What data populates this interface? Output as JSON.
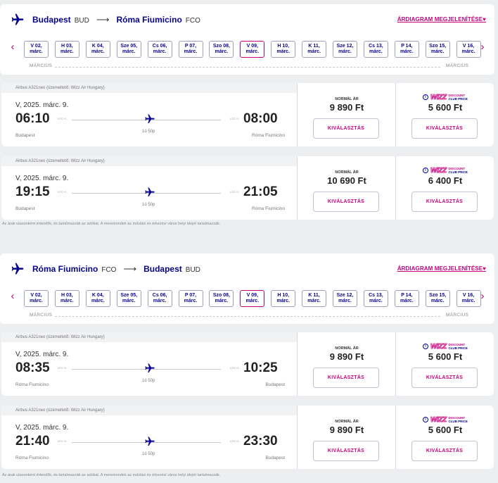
{
  "outbound": {
    "from_city": "Budapest",
    "from_code": "BUD",
    "arrow": "⟶",
    "to_city": "Róma Fiumicino",
    "to_code": "FCO",
    "price_diagram": "ÁRDIAGRAM MEGJELENÍTÉSE♥",
    "dates": [
      {
        "day": "V 02,",
        "month": "márc."
      },
      {
        "day": "H 03,",
        "month": "márc."
      },
      {
        "day": "K 04,",
        "month": "márc."
      },
      {
        "day": "Sze 05,",
        "month": "márc."
      },
      {
        "day": "Cs 06,",
        "month": "márc."
      },
      {
        "day": "P 07,",
        "month": "márc."
      },
      {
        "day": "Szo 08,",
        "month": "márc."
      },
      {
        "day": "V 09,",
        "month": "márc.",
        "selected": true
      },
      {
        "day": "H 10,",
        "month": "márc."
      },
      {
        "day": "K 11,",
        "month": "márc."
      },
      {
        "day": "Sze 12,",
        "month": "márc."
      },
      {
        "day": "Cs 13,",
        "month": "márc."
      },
      {
        "day": "P 14,",
        "month": "márc."
      },
      {
        "day": "Szo 15,",
        "month": "márc."
      },
      {
        "day": "V 16,",
        "month": "márc."
      }
    ],
    "month_left": "MÁRCIUS",
    "month_right": "MÁRCIUS",
    "flights": [
      {
        "operator": "Airbus A321neo (üzemeltető: Wizz Air Hungary)",
        "date": "V, 2025. márc. 9.",
        "dep_time": "06:10",
        "dep_utc": "UTC+1",
        "arr_time": "08:00",
        "arr_utc": "UTC+1",
        "duration": "1ó 50p",
        "dep_city": "Budapest",
        "arr_city": "Róma Fiumicino",
        "normal_label": "NORMÁL ÁR",
        "normal_price": "9 890 Ft",
        "club_price": "5 600 Ft",
        "select": "KIVÁLASZTÁS"
      },
      {
        "operator": "Airbus A321neo (üzemeltető: Wizz Air Hungary)",
        "date": "V, 2025. márc. 9.",
        "dep_time": "19:15",
        "dep_utc": "UTC+1",
        "arr_time": "21:05",
        "arr_utc": "UTC+1",
        "duration": "1ó 50p",
        "dep_city": "Budapest",
        "arr_city": "Róma Fiumicino",
        "normal_label": "NORMÁL ÁR",
        "normal_price": "10 690 Ft",
        "club_price": "6 400 Ft",
        "select": "KIVÁLASZTÁS"
      }
    ]
  },
  "inbound": {
    "from_city": "Róma Fiumicino",
    "from_code": "FCO",
    "arrow": "⟶",
    "to_city": "Budapest",
    "to_code": "BUD",
    "price_diagram": "ÁRDIAGRAM MEGJELENÍTÉSE♥",
    "dates": [
      {
        "day": "V 02,",
        "month": "márc."
      },
      {
        "day": "H 03,",
        "month": "márc."
      },
      {
        "day": "K 04,",
        "month": "márc."
      },
      {
        "day": "Sze 05,",
        "month": "márc."
      },
      {
        "day": "Cs 06,",
        "month": "márc."
      },
      {
        "day": "P 07,",
        "month": "márc."
      },
      {
        "day": "Szo 08,",
        "month": "márc."
      },
      {
        "day": "V 09,",
        "month": "márc.",
        "selected": true
      },
      {
        "day": "H 10,",
        "month": "márc."
      },
      {
        "day": "K 11,",
        "month": "márc."
      },
      {
        "day": "Sze 12,",
        "month": "márc."
      },
      {
        "day": "Cs 13,",
        "month": "márc."
      },
      {
        "day": "P 14,",
        "month": "márc."
      },
      {
        "day": "Szo 15,",
        "month": "márc."
      },
      {
        "day": "V 16,",
        "month": "márc."
      }
    ],
    "month_left": "MÁRCIUS",
    "month_right": "MÁRCIUS",
    "flights": [
      {
        "operator": "Airbus A321neo (üzemeltető: Wizz Air Hungary)",
        "date": "V, 2025. márc. 9.",
        "dep_time": "08:35",
        "dep_utc": "UTC+1",
        "arr_time": "10:25",
        "arr_utc": "UTC+1",
        "duration": "1ó 50p",
        "dep_city": "Róma Fiumicino",
        "arr_city": "Budapest",
        "normal_label": "NORMÁL ÁR",
        "normal_price": "9 890 Ft",
        "club_price": "5 600 Ft",
        "select": "KIVÁLASZTÁS"
      },
      {
        "operator": "Airbus A321neo (üzemeltető: Wizz Air Hungary)",
        "date": "V, 2025. márc. 9.",
        "dep_time": "21:40",
        "dep_utc": "UTC+1",
        "arr_time": "23:30",
        "arr_utc": "UTC+1",
        "duration": "1ó 50p",
        "dep_city": "Róma Fiumicino",
        "arr_city": "Budapest",
        "normal_label": "NORMÁL ÁR",
        "normal_price": "9 890 Ft",
        "club_price": "5 600 Ft",
        "select": "KIVÁLASZTÁS"
      }
    ]
  },
  "club_logo": {
    "badge": "i",
    "wizz": "WIZZ",
    "line1": "DISCOUNT",
    "line2": "CLUB PRICE"
  },
  "disclaimer": "Az árak utasonként értendők, és tartalmazzák az adókat. A menetrendek az indulási és érkezési város helyi idejét tartalmazzák.",
  "colors": {
    "brand_navy": "#06038d",
    "brand_magenta": "#c6007e",
    "background": "#eceef0"
  },
  "icons": {
    "nav_prev": "‹",
    "nav_next": "›"
  }
}
